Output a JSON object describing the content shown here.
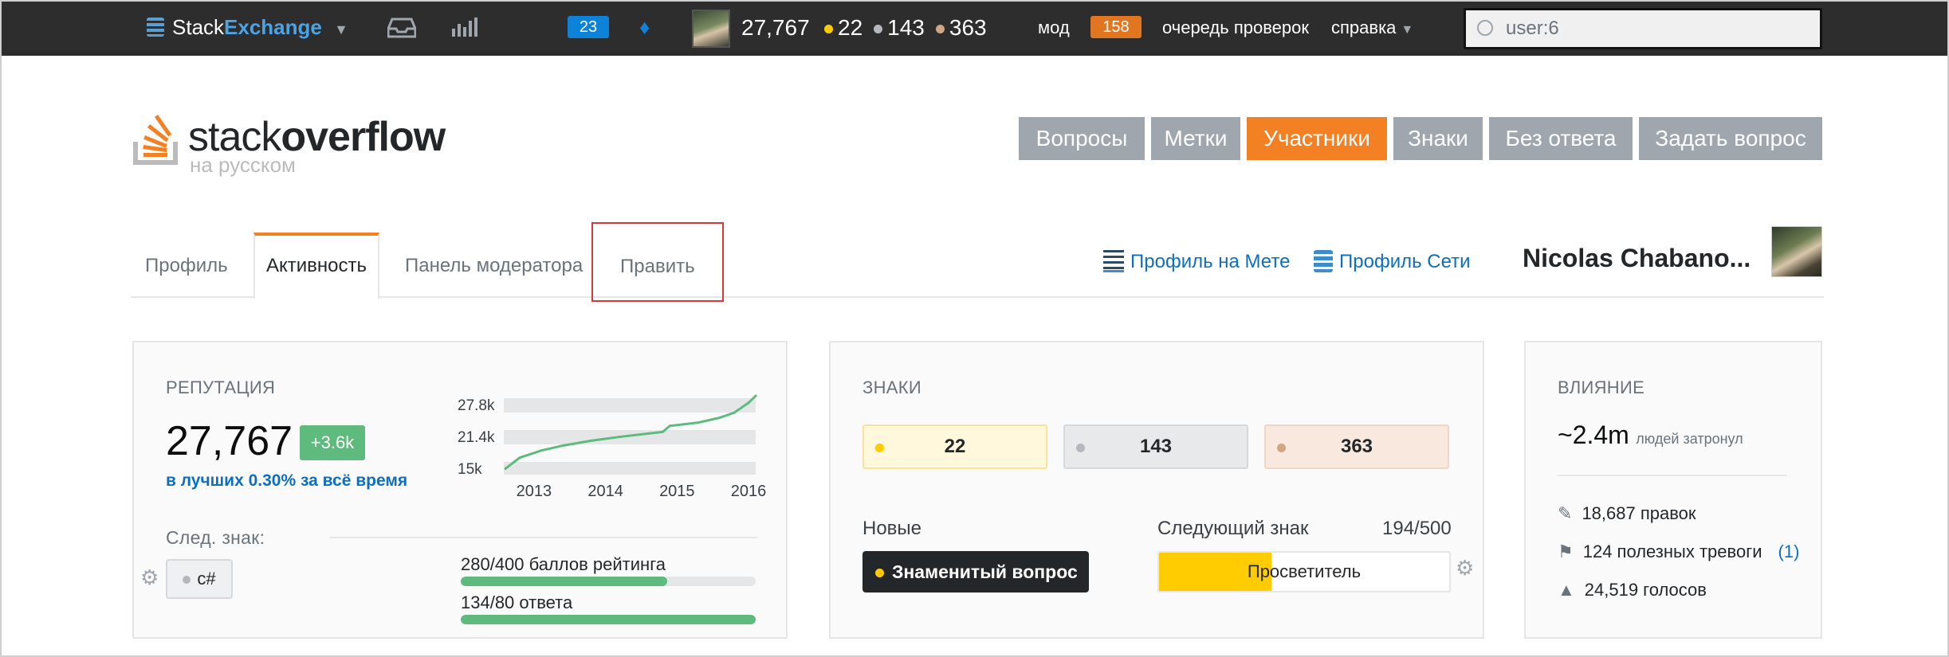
{
  "topbar": {
    "brand_a": "Stack",
    "brand_b": "Exchange",
    "inbox_badge": "23",
    "reputation": "27,767",
    "gold": "22",
    "silver": "143",
    "bronze": "363",
    "mod_label": "мод",
    "mod_count": "158",
    "review_label": "очередь проверок",
    "help_label": "справка",
    "search_value": "user:6"
  },
  "site": {
    "logo_a": "stack",
    "logo_b": "overflow",
    "logo_sub": "на русском"
  },
  "nav": {
    "items": [
      "Вопросы",
      "Метки",
      "Участники",
      "Знаки",
      "Без ответа",
      "Задать вопрос"
    ],
    "active": "Участники"
  },
  "tabs": {
    "profile": "Профиль",
    "activity": "Активность",
    "mod_panel": "Панель модератора",
    "edit": "Править"
  },
  "links": {
    "meta": "Профиль на Мете",
    "network": "Профиль Сети"
  },
  "user": {
    "name": "Nicolas Chabano..."
  },
  "reputation": {
    "heading": "РЕПУТАЦИЯ",
    "value": "27,767",
    "delta": "+3.6k",
    "top": "в лучших 0.30% за всё время",
    "next_badge_label": "След. знак:",
    "next_badge_tag": "c#",
    "progress1_label": "280/400 баллов рейтинга",
    "progress1": 0.7,
    "progress2_label": "134/80 ответа",
    "progress2": 1.0
  },
  "chart_data": {
    "type": "line",
    "y_ticks": [
      "27.8k",
      "21.4k",
      "15k"
    ],
    "x_ticks": [
      "2013",
      "2014",
      "2015",
      "2016"
    ],
    "x": [
      2012.8,
      2013.0,
      2013.3,
      2013.6,
      2014.0,
      2014.4,
      2014.8,
      2015.0,
      2015.1,
      2015.5,
      2015.8,
      2016.0,
      2016.2,
      2016.3
    ],
    "y": [
      14500,
      16500,
      17800,
      18700,
      19600,
      20300,
      20900,
      21200,
      22300,
      22900,
      23800,
      24700,
      26500,
      27767
    ],
    "ylim": [
      14000,
      28500
    ]
  },
  "badges": {
    "heading": "ЗНАКИ",
    "gold": "22",
    "silver": "143",
    "bronze": "363",
    "new_label": "Новые",
    "new_badge": "Знаменитый вопрос",
    "next_label": "Следующий знак",
    "next_progress": "194/500",
    "next_badge": "Просветитель",
    "next_fraction": 0.388
  },
  "impact": {
    "heading": "ВЛИЯНИЕ",
    "people": "~2.4m",
    "people_label": "людей затронул",
    "edits": "18,687 правок",
    "flags": "124 полезных тревоги",
    "flags_extra": "(1)",
    "votes": "24,519 голосов"
  }
}
